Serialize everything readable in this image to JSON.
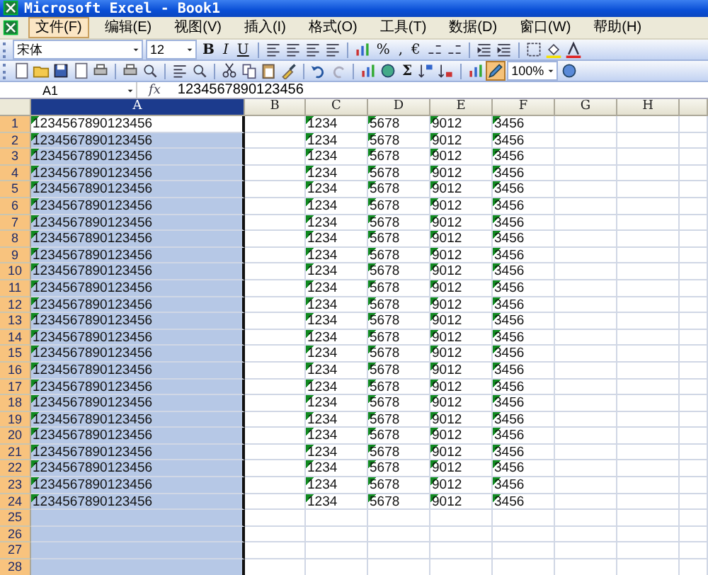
{
  "window": {
    "title": "Microsoft Excel - Book1"
  },
  "menu": [
    {
      "label": "文件(F)",
      "selected": true
    },
    {
      "label": "编辑(E)",
      "selected": false
    },
    {
      "label": "视图(V)",
      "selected": false
    },
    {
      "label": "插入(I)",
      "selected": false
    },
    {
      "label": "格式(O)",
      "selected": false
    },
    {
      "label": "工具(T)",
      "selected": false
    },
    {
      "label": "数据(D)",
      "selected": false
    },
    {
      "label": "窗口(W)",
      "selected": false
    },
    {
      "label": "帮助(H)",
      "selected": false
    }
  ],
  "format_toolbar": {
    "font": "宋体",
    "size": "12",
    "style_buttons": [
      "B",
      "I",
      "U"
    ],
    "number_buttons": [
      "%",
      ",",
      "€"
    ]
  },
  "standard_toolbar": {
    "sum_button": "Σ",
    "zoom": "100%",
    "drawing_pressed": true
  },
  "formula_bar": {
    "name_box": "A1",
    "function_label": "fx",
    "value": "1234567890123456"
  },
  "columns": [
    {
      "label": "A",
      "selected": true
    },
    {
      "label": "B",
      "selected": false
    },
    {
      "label": "C",
      "selected": false
    },
    {
      "label": "D",
      "selected": false
    },
    {
      "label": "E",
      "selected": false
    },
    {
      "label": "F",
      "selected": false
    },
    {
      "label": "G",
      "selected": false
    },
    {
      "label": "H",
      "selected": false
    }
  ],
  "rows": [
    {
      "header": "1",
      "active": true,
      "text_numbers": true,
      "a": "1234567890123456",
      "c": "1234",
      "d": "5678",
      "e": "9012",
      "f": "3456"
    },
    {
      "header": "2",
      "active": false,
      "text_numbers": true,
      "a": "1234567890123456",
      "c": "1234",
      "d": "5678",
      "e": "9012",
      "f": "3456"
    },
    {
      "header": "3",
      "active": false,
      "text_numbers": true,
      "a": "1234567890123456",
      "c": "1234",
      "d": "5678",
      "e": "9012",
      "f": "3456"
    },
    {
      "header": "4",
      "active": false,
      "text_numbers": true,
      "a": "1234567890123456",
      "c": "1234",
      "d": "5678",
      "e": "9012",
      "f": "3456"
    },
    {
      "header": "5",
      "active": false,
      "text_numbers": true,
      "a": "1234567890123456",
      "c": "1234",
      "d": "5678",
      "e": "9012",
      "f": "3456"
    },
    {
      "header": "6",
      "active": false,
      "text_numbers": true,
      "a": "1234567890123456",
      "c": "1234",
      "d": "5678",
      "e": "9012",
      "f": "3456"
    },
    {
      "header": "7",
      "active": false,
      "text_numbers": true,
      "a": "1234567890123456",
      "c": "1234",
      "d": "5678",
      "e": "9012",
      "f": "3456"
    },
    {
      "header": "8",
      "active": false,
      "text_numbers": true,
      "a": "1234567890123456",
      "c": "1234",
      "d": "5678",
      "e": "9012",
      "f": "3456"
    },
    {
      "header": "9",
      "active": false,
      "text_numbers": true,
      "a": "1234567890123456",
      "c": "1234",
      "d": "5678",
      "e": "9012",
      "f": "3456"
    },
    {
      "header": "10",
      "active": false,
      "text_numbers": true,
      "a": "1234567890123456",
      "c": "1234",
      "d": "5678",
      "e": "9012",
      "f": "3456"
    },
    {
      "header": "11",
      "active": false,
      "text_numbers": true,
      "a": "1234567890123456",
      "c": "1234",
      "d": "5678",
      "e": "9012",
      "f": "3456"
    },
    {
      "header": "12",
      "active": false,
      "text_numbers": true,
      "a": "1234567890123456",
      "c": "1234",
      "d": "5678",
      "e": "9012",
      "f": "3456"
    },
    {
      "header": "13",
      "active": false,
      "text_numbers": true,
      "a": "1234567890123456",
      "c": "1234",
      "d": "5678",
      "e": "9012",
      "f": "3456"
    },
    {
      "header": "14",
      "active": false,
      "text_numbers": true,
      "a": "1234567890123456",
      "c": "1234",
      "d": "5678",
      "e": "9012",
      "f": "3456"
    },
    {
      "header": "15",
      "active": false,
      "text_numbers": true,
      "a": "1234567890123456",
      "c": "1234",
      "d": "5678",
      "e": "9012",
      "f": "3456"
    },
    {
      "header": "16",
      "active": false,
      "text_numbers": true,
      "a": "1234567890123456",
      "c": "1234",
      "d": "5678",
      "e": "9012",
      "f": "3456"
    },
    {
      "header": "17",
      "active": false,
      "text_numbers": true,
      "a": "1234567890123456",
      "c": "1234",
      "d": "5678",
      "e": "9012",
      "f": "3456"
    },
    {
      "header": "18",
      "active": false,
      "text_numbers": true,
      "a": "1234567890123456",
      "c": "1234",
      "d": "5678",
      "e": "9012",
      "f": "3456"
    },
    {
      "header": "19",
      "active": false,
      "text_numbers": true,
      "a": "1234567890123456",
      "c": "1234",
      "d": "5678",
      "e": "9012",
      "f": "3456"
    },
    {
      "header": "20",
      "active": false,
      "text_numbers": true,
      "a": "1234567890123456",
      "c": "1234",
      "d": "5678",
      "e": "9012",
      "f": "3456"
    },
    {
      "header": "21",
      "active": false,
      "text_numbers": true,
      "a": "1234567890123456",
      "c": "1234",
      "d": "5678",
      "e": "9012",
      "f": "3456"
    },
    {
      "header": "22",
      "active": false,
      "text_numbers": true,
      "a": "1234567890123456",
      "c": "1234",
      "d": "5678",
      "e": "9012",
      "f": "3456"
    },
    {
      "header": "23",
      "active": false,
      "text_numbers": true,
      "a": "1234567890123456",
      "c": "1234",
      "d": "5678",
      "e": "9012",
      "f": "3456"
    },
    {
      "header": "24",
      "active": false,
      "text_numbers": true,
      "a": "1234567890123456",
      "c": "1234",
      "d": "5678",
      "e": "9012",
      "f": "3456"
    },
    {
      "header": "25",
      "active": false
    },
    {
      "header": "26",
      "active": false
    },
    {
      "header": "27",
      "active": false
    },
    {
      "header": "28",
      "active": false
    }
  ]
}
